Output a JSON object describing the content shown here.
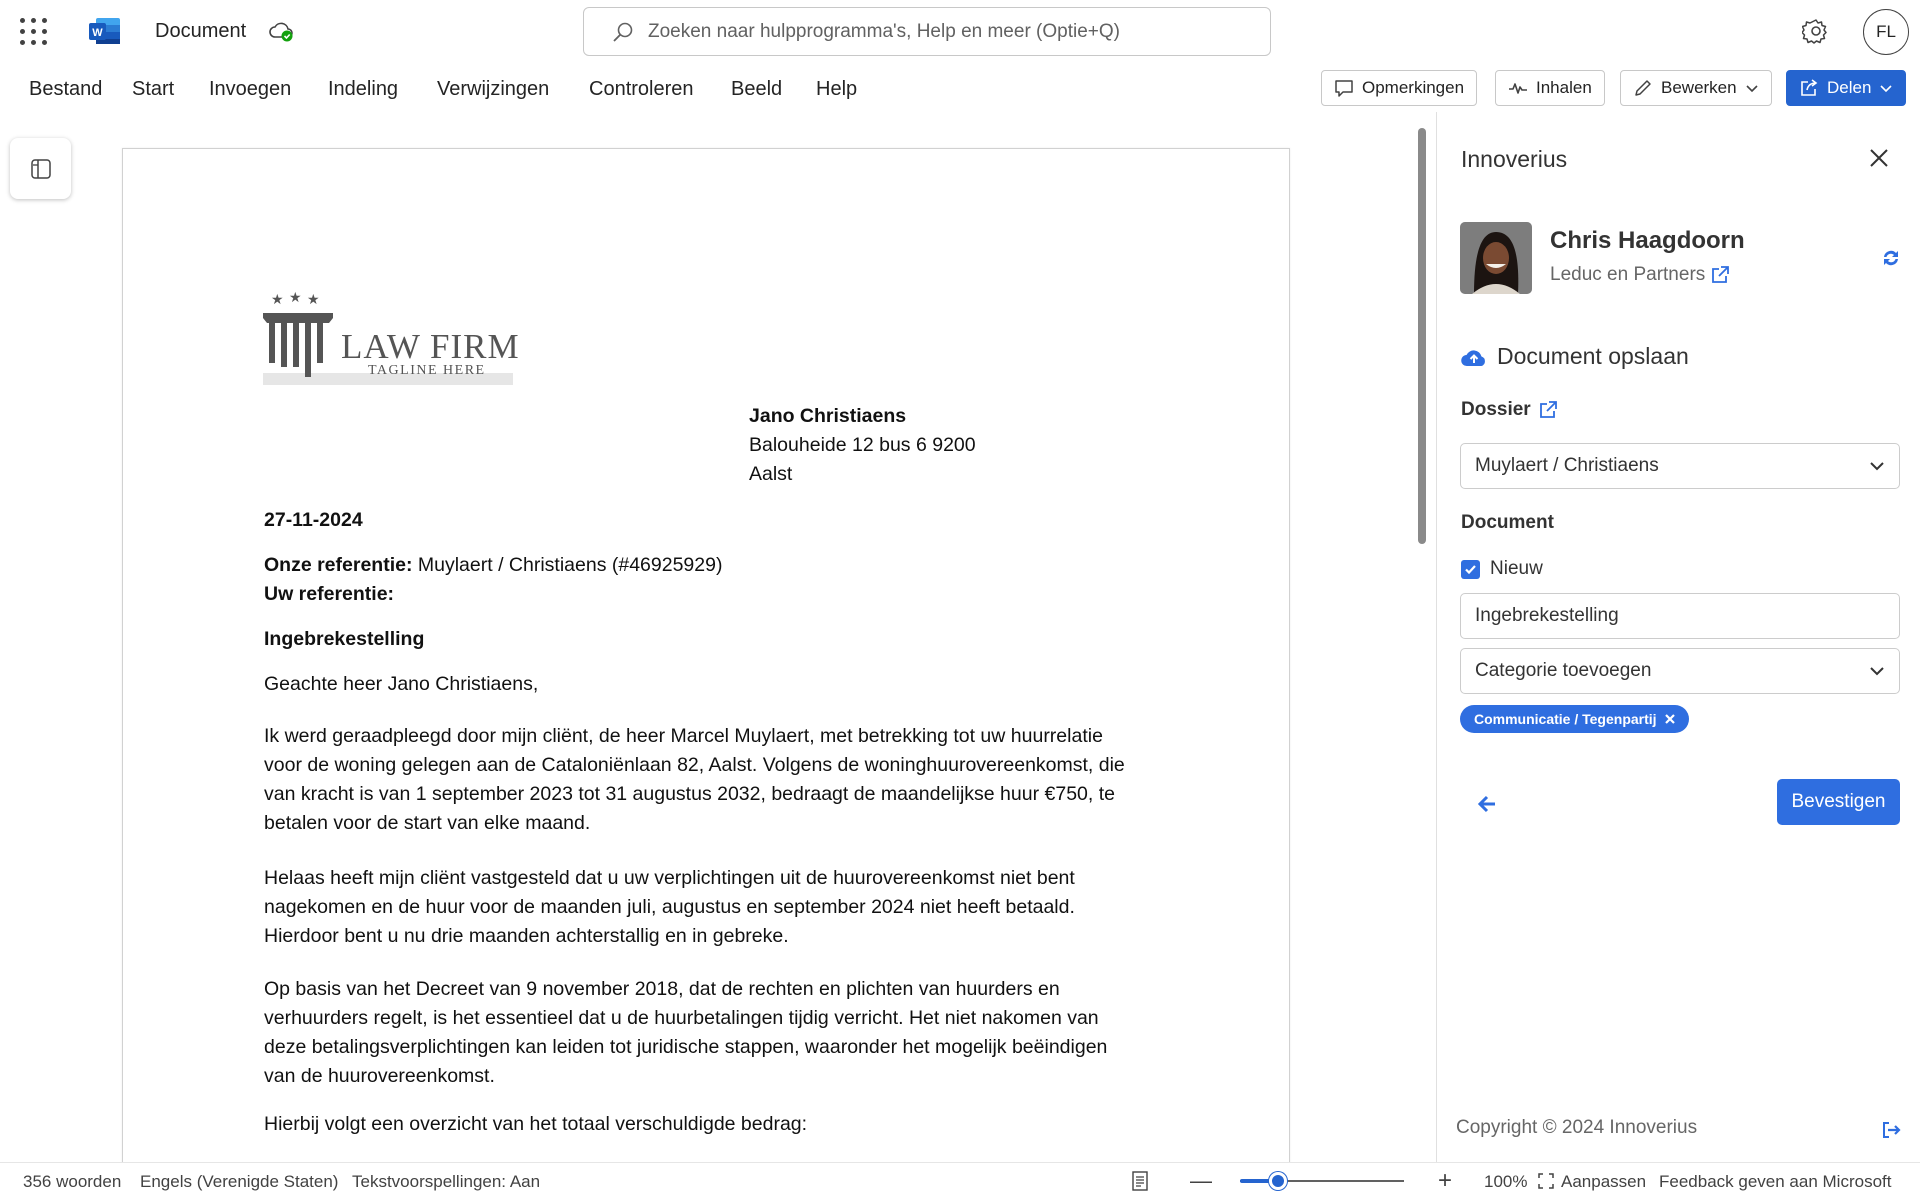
{
  "app": {
    "doc_title": "Document",
    "search_placeholder": "Zoeken naar hulpprogramma's, Help en meer (Optie+Q)",
    "user_initials": "FL"
  },
  "menu": [
    "Bestand",
    "Start",
    "Invoegen",
    "Indeling",
    "Verwijzingen",
    "Controleren",
    "Beeld",
    "Help"
  ],
  "ribbon_buttons": {
    "comments": "Opmerkingen",
    "catchup": "Inhalen",
    "edit": "Bewerken",
    "share": "Delen"
  },
  "letter": {
    "logo_title": "LAW FIRM",
    "logo_tagline": "TAGLINE HERE",
    "recipient_name": "Jano Christiaens",
    "recipient_street": "Balouheide 12 bus 6 9200",
    "recipient_city": "Aalst",
    "date": "27-11-2024",
    "our_ref_label": "Onze referentie:",
    "our_ref_value": " Muylaert / Christiaens (#46925929)",
    "your_ref_label": "Uw referentie:",
    "subject": "Ingebrekestelling",
    "salutation": "Geachte heer Jano Christiaens,",
    "p1": [
      "Ik werd geraadpleegd door mijn cliënt, de heer Marcel Muylaert, met betrekking tot uw huurrelatie",
      "voor de woning gelegen aan de Cataloniënlaan 82, Aalst. Volgens de woninghuurovereenkomst, die",
      "van kracht is van 1 september 2023 tot 31 augustus 2032, bedraagt de maandelijkse huur €750, te",
      "betalen voor de start van elke maand."
    ],
    "p2": [
      "Helaas heeft mijn cliënt vastgesteld dat u uw verplichtingen uit de huurovereenkomst niet bent",
      "nagekomen en de huur voor de maanden juli, augustus en september 2024 niet heeft betaald.",
      "Hierdoor bent u nu drie maanden achterstallig en in gebreke."
    ],
    "p3": [
      "Op basis van het Decreet van 9 november 2018, dat de rechten en plichten van huurders en",
      "verhuurders regelt, is het essentieel dat u de huurbetalingen tijdig verricht. Het niet nakomen van",
      "deze betalingsverplichtingen kan leiden tot juridische stappen, waaronder het mogelijk beëindigen",
      "van de huurovereenkomst."
    ],
    "p4": "Hierbij volgt een overzicht van het totaal verschuldigde bedrag:"
  },
  "panel": {
    "title": "Innoverius",
    "contact_name": "Chris Haagdoorn",
    "contact_org": "Leduc en Partners",
    "save_heading": "Document opslaan",
    "dossier_label": "Dossier",
    "dossier_value": "Muylaert / Christiaens",
    "document_label": "Document",
    "new_checkbox_label": "Nieuw",
    "new_checked": true,
    "document_name": "Ingebrekestelling",
    "category_placeholder": "Categorie toevoegen",
    "tag": "Communicatie / Tegenpartij",
    "confirm": "Bevestigen",
    "copyright": "Copyright © 2024 Innoverius",
    "accent": "#2f6ee0"
  },
  "status": {
    "words": "356 woorden",
    "language": "Engels (Verenigde Staten)",
    "predictions": "Tekstvoorspellingen: Aan",
    "zoom": "100%",
    "zoom_level": 0.23,
    "fit": "Aanpassen",
    "feedback": "Feedback geven aan Microsoft"
  }
}
